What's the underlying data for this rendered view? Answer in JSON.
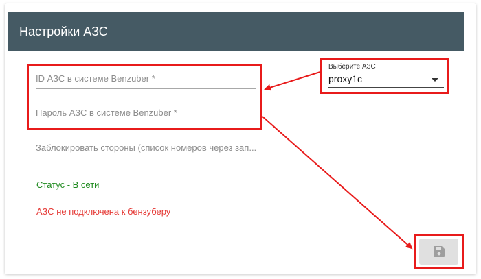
{
  "header": {
    "title": "Настройки АЗС"
  },
  "form": {
    "id_placeholder": "ID АЗС в системе Benzuber *",
    "password_placeholder": "Пароль АЗС в системе Benzuber *",
    "block_placeholder": "Заблокировать стороны (список номеров через зап..."
  },
  "status": {
    "online": "Статус - В сети",
    "not_connected": "АЗС не подключена к бензуберу"
  },
  "station_select": {
    "label": "Выберите АЗС",
    "value": "proxy1c"
  },
  "save_button": {
    "icon": "floppy-disk-icon"
  },
  "colors": {
    "header_bg": "#455a64",
    "highlight": "#e81b1b",
    "status_ok": "#1e8a1e",
    "status_err": "#e53935"
  }
}
